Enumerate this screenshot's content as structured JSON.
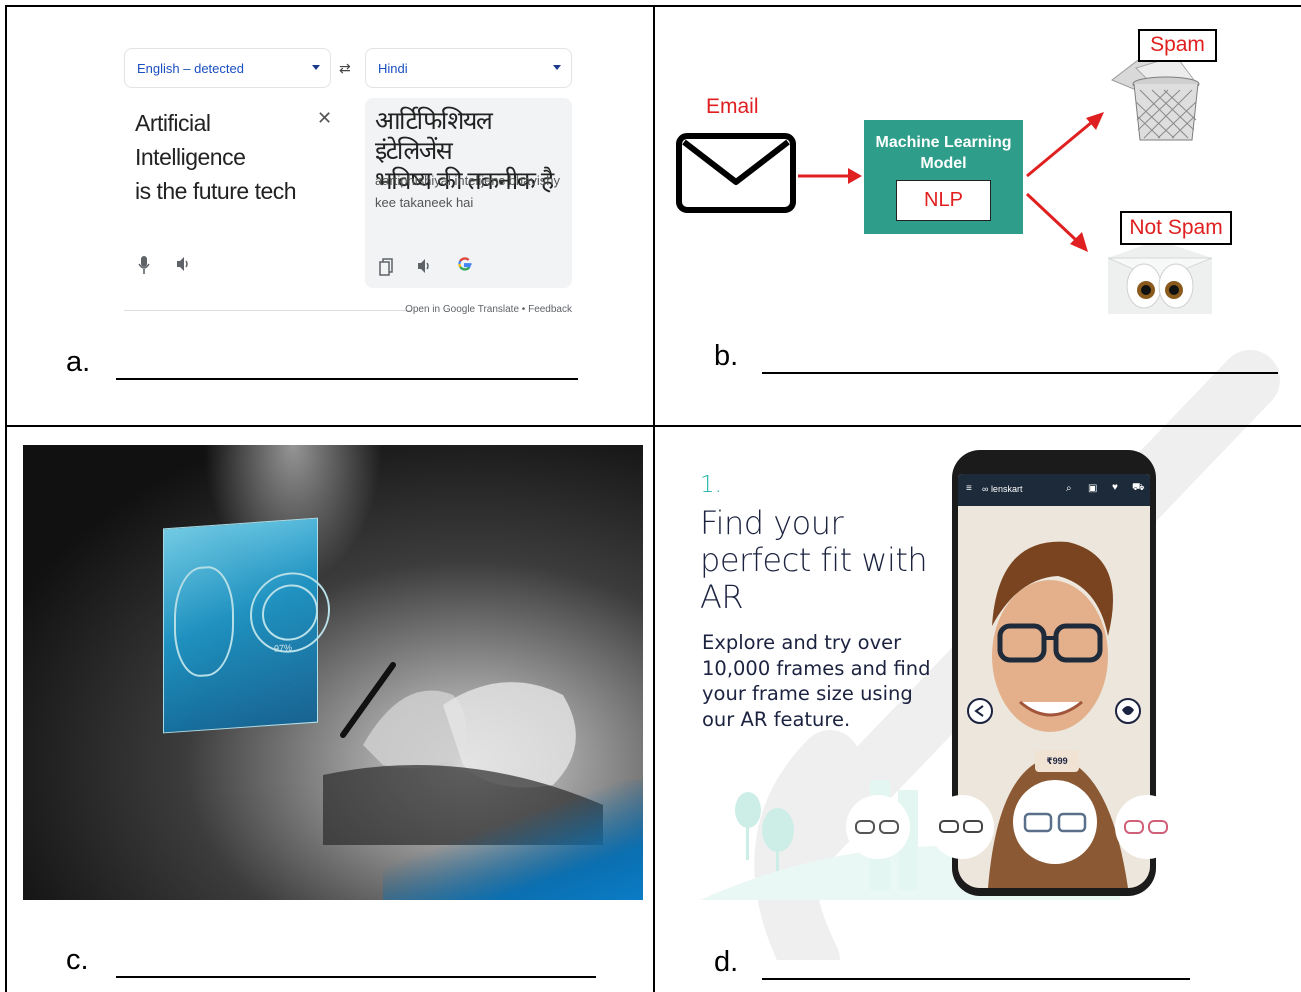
{
  "labels": {
    "a": "a.",
    "b": "b.",
    "c": "c.",
    "d": "d."
  },
  "translate": {
    "source_lang": "English – detected",
    "target_lang": "Hindi",
    "source_text_line1": "Artificial Intelligence",
    "source_text_line2": "is the future tech",
    "target_text_line1": "आर्टिफिशियल इंटेलिजेंस",
    "target_text_line2": "भविष्य की तकनीक है",
    "romanization": "aartiphishiyal intelijens bhavishy kee takaneek hai",
    "footer": "Open in Google Translate  •  Feedback",
    "icons": [
      "swap-icon",
      "clear-icon",
      "mic-icon",
      "speaker-icon",
      "copy-icon",
      "speaker-icon",
      "google-g-icon"
    ]
  },
  "spam_diagram": {
    "input_label": "Email",
    "model_title": "Machine Learning Model",
    "model_sub": "NLP",
    "output_spam": "Spam",
    "output_not_spam": "Not Spam",
    "colors": {
      "arrow": "#e02020",
      "model_box": "#2e9e8a"
    }
  },
  "lenskart": {
    "step": "1.",
    "headline": "Find your perfect fit with AR",
    "body": "Explore and try over 10,000 frames and find your frame size using our AR feature.",
    "app_brand": "lenskart",
    "price": "₹999",
    "accent_color": "#19b3a5"
  }
}
